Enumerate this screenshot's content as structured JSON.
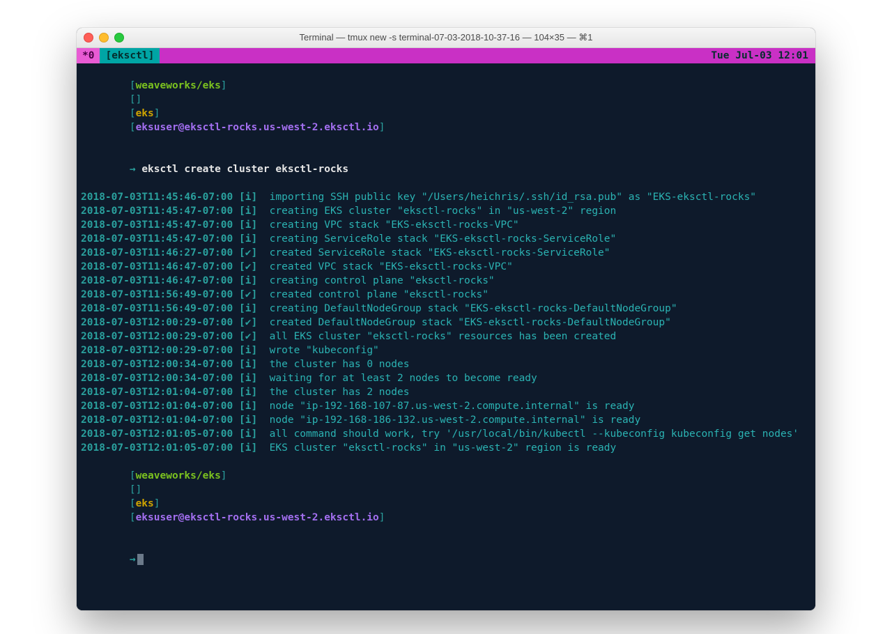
{
  "titlebar": {
    "title": "Terminal — tmux new -s terminal-07-03-2018-10-37-16 — 104×35 — ⌘1"
  },
  "tmux": {
    "index": "*0",
    "window": "[eksctl]",
    "clock": "Tue Jul-03 12:01"
  },
  "prompt": {
    "bracket_open": "[",
    "repo": "weaveworks/eks",
    "bracket_close": "]",
    "empty_pair": "[]",
    "env_open": "[",
    "env": "eks",
    "env_close": "]",
    "userhost_open": "[",
    "userhost": "eksuser@eksctl-rocks.us-west-2.eksctl.io",
    "userhost_close": "]",
    "arrow": "→"
  },
  "command": "eksctl create cluster eksctl-rocks",
  "log": [
    {
      "ts": "2018-07-03T11:45:46-07:00",
      "lvl": "[i]",
      "msg": "importing SSH public key \"/Users/heichris/.ssh/id_rsa.pub\" as \"EKS-eksctl-rocks\""
    },
    {
      "ts": "2018-07-03T11:45:47-07:00",
      "lvl": "[i]",
      "msg": "creating EKS cluster \"eksctl-rocks\" in \"us-west-2\" region"
    },
    {
      "ts": "2018-07-03T11:45:47-07:00",
      "lvl": "[i]",
      "msg": "creating VPC stack \"EKS-eksctl-rocks-VPC\""
    },
    {
      "ts": "2018-07-03T11:45:47-07:00",
      "lvl": "[i]",
      "msg": "creating ServiceRole stack \"EKS-eksctl-rocks-ServiceRole\""
    },
    {
      "ts": "2018-07-03T11:46:27-07:00",
      "lvl": "[✔]",
      "msg": "created ServiceRole stack \"EKS-eksctl-rocks-ServiceRole\""
    },
    {
      "ts": "2018-07-03T11:46:47-07:00",
      "lvl": "[✔]",
      "msg": "created VPC stack \"EKS-eksctl-rocks-VPC\""
    },
    {
      "ts": "2018-07-03T11:46:47-07:00",
      "lvl": "[i]",
      "msg": "creating control plane \"eksctl-rocks\""
    },
    {
      "ts": "2018-07-03T11:56:49-07:00",
      "lvl": "[✔]",
      "msg": "created control plane \"eksctl-rocks\""
    },
    {
      "ts": "2018-07-03T11:56:49-07:00",
      "lvl": "[i]",
      "msg": "creating DefaultNodeGroup stack \"EKS-eksctl-rocks-DefaultNodeGroup\""
    },
    {
      "ts": "2018-07-03T12:00:29-07:00",
      "lvl": "[✔]",
      "msg": "created DefaultNodeGroup stack \"EKS-eksctl-rocks-DefaultNodeGroup\""
    },
    {
      "ts": "2018-07-03T12:00:29-07:00",
      "lvl": "[✔]",
      "msg": "all EKS cluster \"eksctl-rocks\" resources has been created"
    },
    {
      "ts": "2018-07-03T12:00:29-07:00",
      "lvl": "[i]",
      "msg": "wrote \"kubeconfig\""
    },
    {
      "ts": "2018-07-03T12:00:34-07:00",
      "lvl": "[i]",
      "msg": "the cluster has 0 nodes"
    },
    {
      "ts": "2018-07-03T12:00:34-07:00",
      "lvl": "[i]",
      "msg": "waiting for at least 2 nodes to become ready"
    },
    {
      "ts": "2018-07-03T12:01:04-07:00",
      "lvl": "[i]",
      "msg": "the cluster has 2 nodes"
    },
    {
      "ts": "2018-07-03T12:01:04-07:00",
      "lvl": "[i]",
      "msg": "node \"ip-192-168-107-87.us-west-2.compute.internal\" is ready"
    },
    {
      "ts": "2018-07-03T12:01:04-07:00",
      "lvl": "[i]",
      "msg": "node \"ip-192-168-186-132.us-west-2.compute.internal\" is ready"
    },
    {
      "ts": "2018-07-03T12:01:05-07:00",
      "lvl": "[i]",
      "msg": "all command should work, try '/usr/local/bin/kubectl --kubeconfig kubeconfig get nodes'"
    },
    {
      "ts": "2018-07-03T12:01:05-07:00",
      "lvl": "[i]",
      "msg": "EKS cluster \"eksctl-rocks\" in \"us-west-2\" region is ready"
    }
  ]
}
